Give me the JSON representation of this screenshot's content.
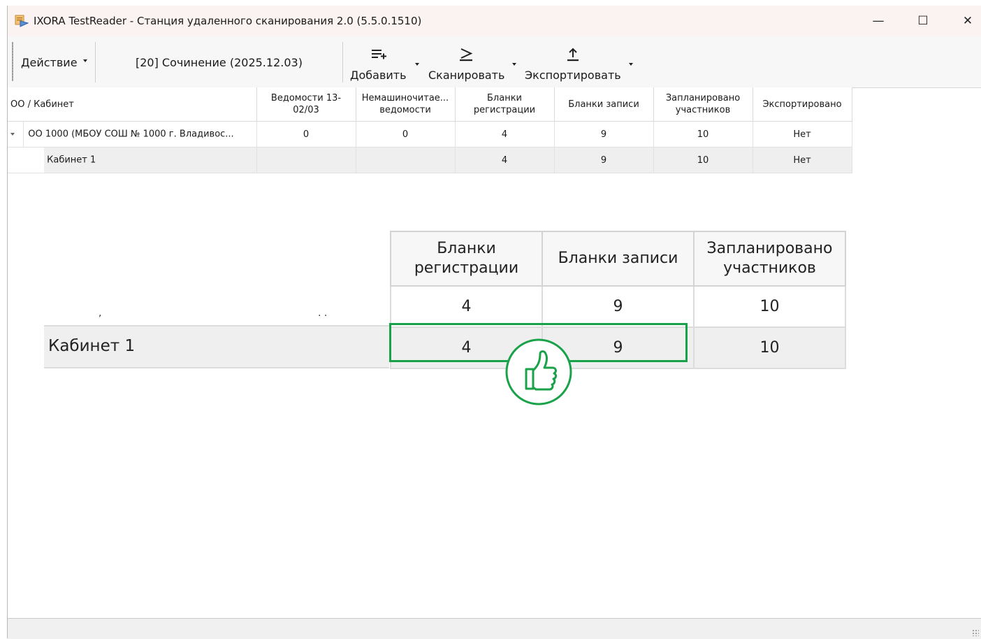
{
  "window": {
    "title": "IXORA TestReader - Станция удаленного сканирования 2.0 (5.5.0.1510)",
    "controls": {
      "minimize": "—",
      "maximize": "☐",
      "close": "✕"
    }
  },
  "toolbar": {
    "action_label": "Действие",
    "exam_label": "[20] Сочинение (2025.12.03)",
    "add_label": "Добавить",
    "scan_label": "Сканировать",
    "export_label": "Экспортировать"
  },
  "grid": {
    "columns": [
      "ОО / Кабинет",
      "Ведомости 13-02/03",
      "Немашиночитае... ведомости",
      "Бланки регистрации",
      "Бланки записи",
      "Запланировано участников",
      "Экспортировано"
    ],
    "rows": [
      {
        "name": "ОО 1000 (МБОУ СОШ № 1000 г. Владивос...",
        "vedomosti": "0",
        "nemash": "0",
        "reg": "4",
        "zapisi": "9",
        "planned": "10",
        "exported": "Нет"
      },
      {
        "name": "Кабинет 1",
        "vedomosti": "",
        "nemash": "",
        "reg": "4",
        "zapisi": "9",
        "planned": "10",
        "exported": "Нет"
      }
    ]
  },
  "zoom": {
    "columns": [
      "Бланки регистрации",
      "Бланки записи",
      "Запланировано участников"
    ],
    "rows": [
      [
        "4",
        "9",
        "10"
      ],
      [
        "4",
        "9",
        "10"
      ]
    ],
    "row_label": "Кабинет 1",
    "fragment_dots": [
      ",",
      ". ."
    ],
    "highlight_color": "#1aa24a"
  },
  "icons": [
    "app-icon",
    "add-list-icon",
    "scan-icon",
    "export-icon",
    "thumbs-up-icon",
    "expand-arrow-icon"
  ]
}
